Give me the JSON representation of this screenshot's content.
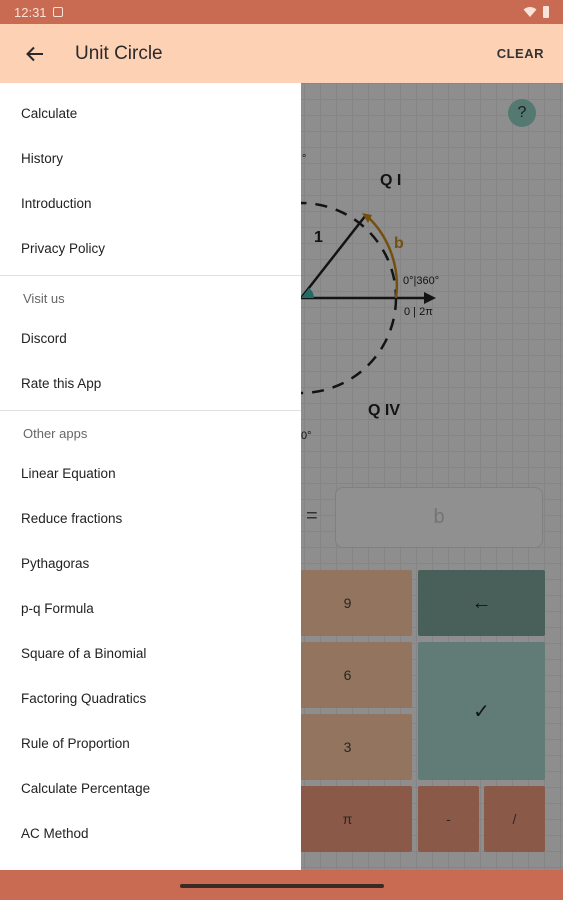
{
  "status": {
    "time": "12:31"
  },
  "app_bar": {
    "title": "Unit Circle",
    "clear_label": "CLEAR"
  },
  "content": {
    "help_label": "?",
    "quadrant_1": "Q I",
    "quadrant_4": "Q IV",
    "radius_label": "1",
    "arc_label": "b",
    "angle_deg_label": "0°|360°",
    "angle_rad_label": "0 | 2π",
    "top_tick_label": "°",
    "bottom_tick_label": "0°",
    "equals": "=",
    "answer_placeholder": "b",
    "keys": {
      "nine": "9",
      "six": "6",
      "three": "3",
      "pi": "π",
      "backspace": "←",
      "confirm": "✓",
      "minus": "-",
      "divide": "/"
    }
  },
  "drawer": {
    "main_items": [
      "Calculate",
      "History",
      "Introduction",
      "Privacy Policy"
    ],
    "visit_label": "Visit us",
    "visit_items": [
      "Discord",
      "Rate this App"
    ],
    "other_label": "Other apps",
    "other_items": [
      "Linear Equation",
      "Reduce fractions",
      "Pythagoras",
      "p-q Formula",
      "Square of a Binomial",
      "Factoring Quadratics",
      "Rule of Proportion",
      "Calculate Percentage",
      "AC Method"
    ]
  },
  "colors": {
    "status_bar": "#c96a52",
    "app_bar": "#fdd1b4",
    "accent_arc": "#c98a1b",
    "teal": "#8fd0c2"
  }
}
